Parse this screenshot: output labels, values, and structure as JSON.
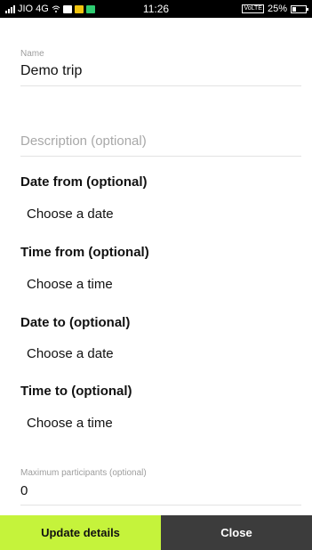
{
  "status_bar": {
    "carrier": "JIO 4G",
    "time": "11:26",
    "volte": "VoLTE",
    "battery": "25%",
    "icons": [
      "signal-icon",
      "wifi-icon",
      "gallery-icon",
      "message-icon",
      "app-icon",
      "battery-icon"
    ]
  },
  "form": {
    "name": {
      "label": "Name",
      "value": "Demo trip"
    },
    "description": {
      "placeholder": "Description (optional)"
    },
    "date_from": {
      "label": "Date from (optional)",
      "action": "Choose a date"
    },
    "time_from": {
      "label": "Time from (optional)",
      "action": "Choose a time"
    },
    "date_to": {
      "label": "Date to (optional)",
      "action": "Choose a date"
    },
    "time_to": {
      "label": "Time to (optional)",
      "action": "Choose a time"
    },
    "max_participants": {
      "label": "Maximum participants (optional)",
      "value": "0"
    }
  },
  "buttons": {
    "update": "Update details",
    "close": "Close"
  },
  "colors": {
    "update_bg": "#c5f33b",
    "close_bg": "#3c3c3c"
  }
}
